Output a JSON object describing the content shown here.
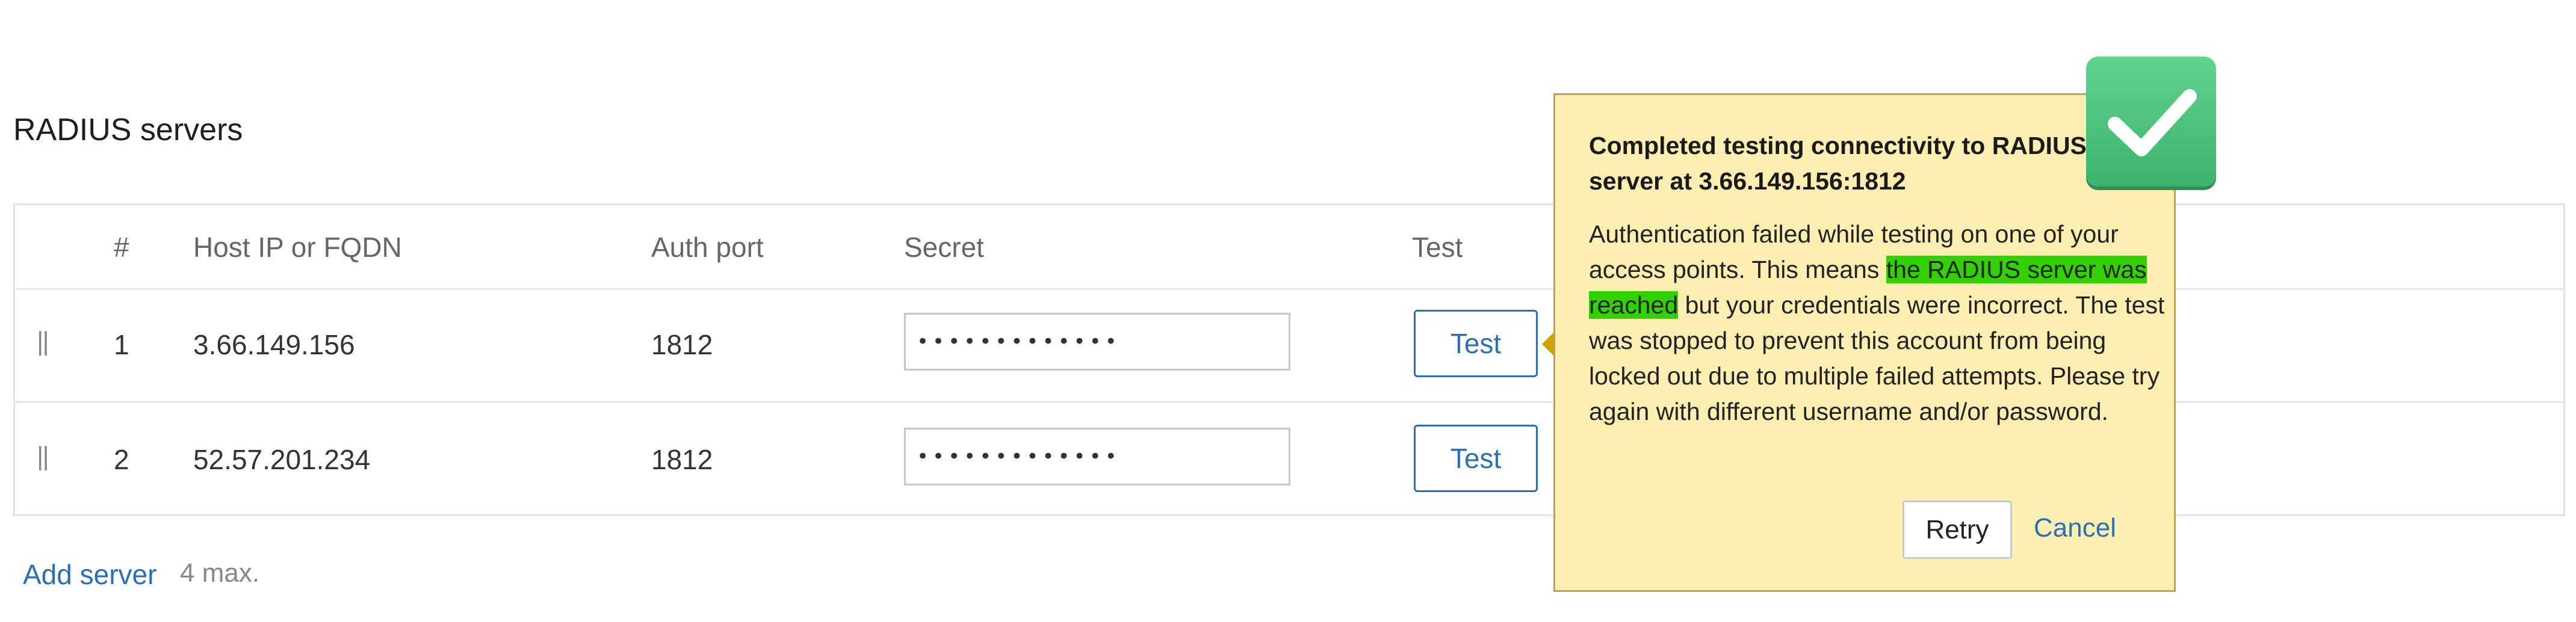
{
  "section": {
    "title": "RADIUS servers"
  },
  "table": {
    "headers": {
      "num": "#",
      "host": "Host IP or FQDN",
      "port": "Auth port",
      "secret": "Secret",
      "test": "Test"
    },
    "rows": [
      {
        "num": "1",
        "host": "3.66.149.156",
        "port": "1812",
        "secret": "•••••••••••••",
        "test_label": "Test"
      },
      {
        "num": "2",
        "host": "52.57.201.234",
        "port": "1812",
        "secret": "•••••••••••••",
        "test_label": "Test"
      }
    ]
  },
  "footer": {
    "add_server": "Add server",
    "max_note": "4 max."
  },
  "popover": {
    "title": "Completed testing connectivity to RADIUS server at 3.66.149.156:1812",
    "body_part1": "Authentication failed while testing on one of your access points. This means ",
    "body_highlight": "the RADIUS server was reached",
    "body_part2": " but your credentials were incorrect. The test was stopped to prevent this account from being locked out due to multiple failed attempts. Please try again with different username and/or password.",
    "retry_label": "Retry",
    "cancel_label": "Cancel"
  },
  "colors": {
    "link": "#2b6fb6",
    "popover_bg": "#fdefb2",
    "highlight": "#32d200",
    "badge": "#3bb36d"
  },
  "icons": {
    "badge": "checkmark-icon",
    "drag": "drag-handle-icon"
  }
}
